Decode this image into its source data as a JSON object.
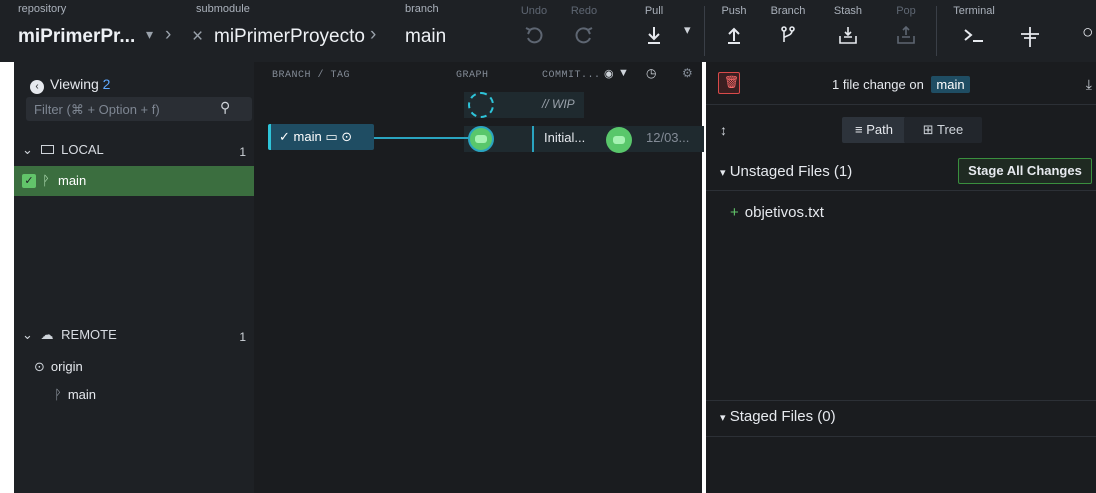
{
  "toolbar": {
    "repository_label": "repository",
    "repository_name": "miPrimerPr...",
    "submodule_label": "submodule",
    "submodule_name": "miPrimerProyecto",
    "branch_label": "branch",
    "branch_name": "main",
    "buttons": {
      "undo": "Undo",
      "redo": "Redo",
      "pull": "Pull",
      "push": "Push",
      "branch": "Branch",
      "stash": "Stash",
      "pop": "Pop",
      "terminal": "Terminal"
    }
  },
  "left_panel": {
    "viewing_label": "Viewing",
    "viewing_count": "2",
    "filter_placeholder": "Filter (⌘ + Option + f)",
    "local": {
      "label": "LOCAL",
      "count": "1",
      "branches": [
        "main"
      ]
    },
    "remote": {
      "label": "REMOTE",
      "count": "1",
      "origin": "origin",
      "branches": [
        "main"
      ]
    }
  },
  "graph_panel": {
    "columns": [
      "BRANCH / TAG",
      "GRAPH",
      "COMMIT..."
    ],
    "wip_label": "// WIP",
    "branch_pill": "main",
    "commit": {
      "message": "Initial...",
      "date": "12/03..."
    }
  },
  "right_panel": {
    "file_change_text": "1 file change on",
    "branch_tag": "main",
    "path_label": "Path",
    "tree_label": "Tree",
    "unstaged_label": "Unstaged Files (1)",
    "stage_all_label": "Stage All Changes",
    "unstaged_files": [
      "objetivos.txt"
    ],
    "staged_label": "Staged Files (0)"
  },
  "colors": {
    "accent": "#2ec4d9",
    "selected_row": "#3b6e3f",
    "stage_btn_border": "#3a8f3e"
  }
}
